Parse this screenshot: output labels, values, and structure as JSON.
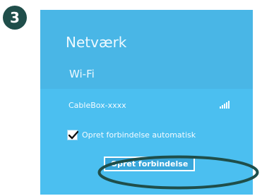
{
  "step": {
    "number": "3"
  },
  "panel": {
    "title": "Netværk",
    "section": "Wi-Fi",
    "network": {
      "name": "CableBox-xxxx",
      "signal_icon": "wifi-signal-bars"
    },
    "auto_connect": {
      "label": "Opret forbindelse automatisk",
      "checked": true
    },
    "connect_button": {
      "label": "Opret forbindelse"
    }
  },
  "colors": {
    "panel_bg": "#4bbff0",
    "header_bg": "#49b6e6",
    "badge_bg": "#1f4e4a",
    "ring": "#1f4e4a"
  }
}
